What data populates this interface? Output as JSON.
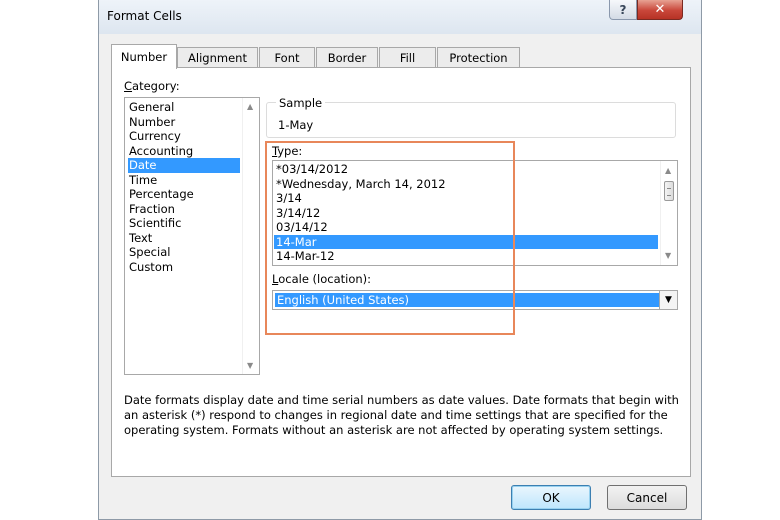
{
  "window": {
    "title": "Format Cells",
    "help_glyph": "?",
    "close_glyph": "✕"
  },
  "tabs": [
    {
      "label": "Number",
      "active": true
    },
    {
      "label": "Alignment",
      "active": false
    },
    {
      "label": "Font",
      "active": false
    },
    {
      "label": "Border",
      "active": false
    },
    {
      "label": "Fill",
      "active": false
    },
    {
      "label": "Protection",
      "active": false
    }
  ],
  "category": {
    "label_accel": "C",
    "label_rest": "ategory:",
    "items": [
      "General",
      "Number",
      "Currency",
      "Accounting",
      "Date",
      "Time",
      "Percentage",
      "Fraction",
      "Scientific",
      "Text",
      "Special",
      "Custom"
    ],
    "selected": "Date"
  },
  "sample": {
    "label": "Sample",
    "value": "1-May"
  },
  "type": {
    "label_accel": "T",
    "label_rest": "ype:",
    "items": [
      "*03/14/2012",
      "*Wednesday, March 14, 2012",
      "3/14",
      "3/14/12",
      "03/14/12",
      "14-Mar",
      "14-Mar-12"
    ],
    "selected": "14-Mar"
  },
  "locale": {
    "label_accel": "L",
    "label_rest": "ocale (location):",
    "value": "English (United States)"
  },
  "description": "Date formats display date and time serial numbers as date values.  Date formats that begin with an asterisk (*) respond to changes in regional date and time settings that are specified for the operating system. Formats without an asterisk are not affected by operating system settings.",
  "buttons": {
    "ok": "OK",
    "cancel": "Cancel"
  },
  "colors": {
    "selection": "#3399ff",
    "highlight_box": "#e8875a",
    "close_button": "#c9473a"
  }
}
